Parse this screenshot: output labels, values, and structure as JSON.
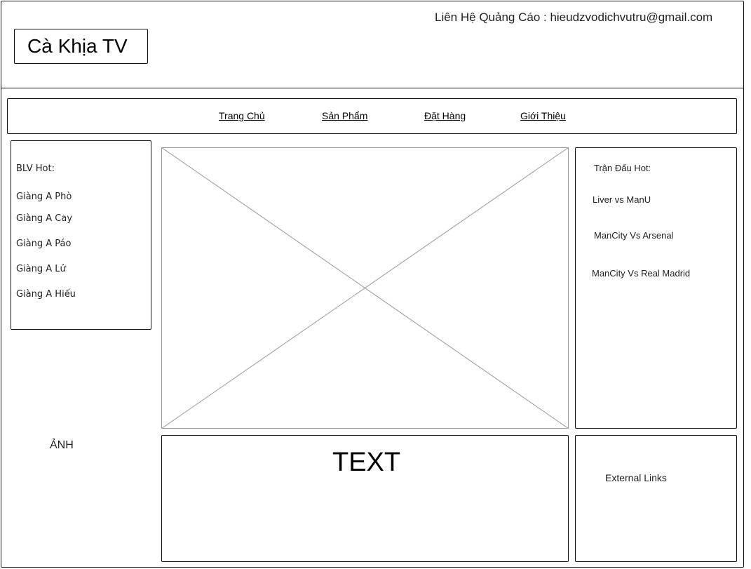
{
  "header": {
    "contact": "Liên Hệ Quảng Cáo : hieudzvodichvutru@gmail.com",
    "logo_text": "Cà Khịa TV"
  },
  "nav": {
    "items": [
      "Trang Chủ",
      "Sản Phẩm",
      "Đặt Hàng",
      "Giới Thiệu"
    ]
  },
  "left_sidebar": {
    "title": "BLV Hot:",
    "items": [
      "Giàng A Phò",
      "Giàng A Cay",
      "Giàng A Páo",
      "Giàng A Lử",
      "Giàng A Hiếu"
    ],
    "image_label": "ẢNH"
  },
  "main": {
    "text_label": "TEXT"
  },
  "right_sidebar": {
    "title": "Trận Đấu Hot:",
    "items": [
      "Liver vs ManU",
      "ManCity Vs Arsenal",
      "ManCity Vs Real Madrid"
    ],
    "external_links": "External Links"
  }
}
